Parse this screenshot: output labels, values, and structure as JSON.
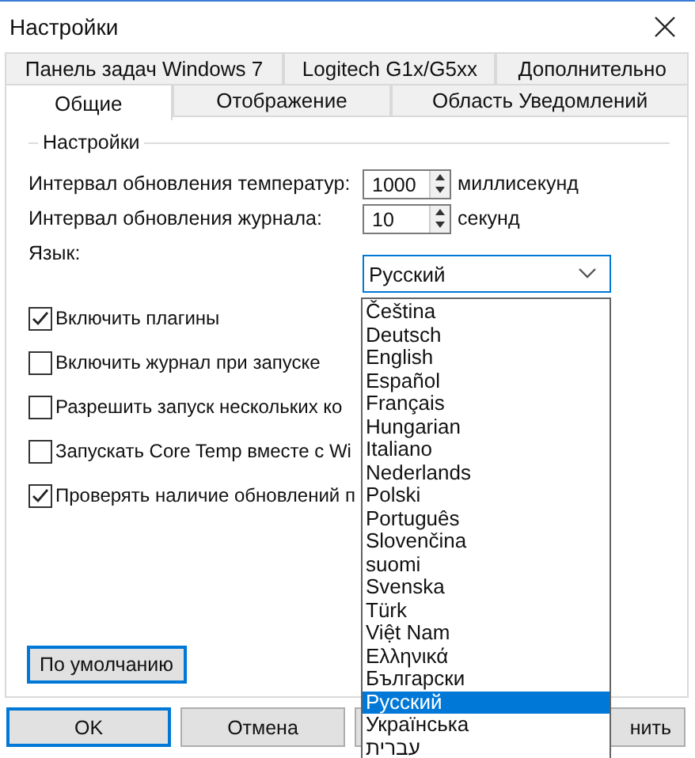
{
  "window": {
    "title": "Настройки"
  },
  "tab_rows": [
    [
      {
        "label": "Панель задач Windows 7",
        "selected": false
      },
      {
        "label": "Logitech G1x/G5xx",
        "selected": false
      },
      {
        "label": "Дополнительно",
        "selected": false
      }
    ],
    [
      {
        "label": "Общие",
        "selected": true
      },
      {
        "label": "Отображение",
        "selected": false
      },
      {
        "label": "Область Уведомлений",
        "selected": false
      }
    ]
  ],
  "group": {
    "title": "Настройки"
  },
  "spinners": [
    {
      "label": "Интервал обновления температур:",
      "value": "1000",
      "unit": "миллисекунд"
    },
    {
      "label": "Интервал обновления журнала:",
      "value": "10",
      "unit": "секунд"
    }
  ],
  "language": {
    "label": "Язык:",
    "value": "Русский",
    "options": [
      {
        "label": "Čeština",
        "selected": false
      },
      {
        "label": "Deutsch",
        "selected": false
      },
      {
        "label": "English",
        "selected": false
      },
      {
        "label": "Español",
        "selected": false
      },
      {
        "label": "Français",
        "selected": false
      },
      {
        "label": "Hungarian",
        "selected": false
      },
      {
        "label": "Italiano",
        "selected": false
      },
      {
        "label": "Nederlands",
        "selected": false
      },
      {
        "label": "Polski",
        "selected": false
      },
      {
        "label": "Português",
        "selected": false
      },
      {
        "label": "Slovenčina",
        "selected": false
      },
      {
        "label": "suomi",
        "selected": false
      },
      {
        "label": "Svenska",
        "selected": false
      },
      {
        "label": "Türk",
        "selected": false
      },
      {
        "label": "Việt Nam",
        "selected": false
      },
      {
        "label": "Ελληνικά",
        "selected": false
      },
      {
        "label": "Български",
        "selected": false
      },
      {
        "label": "Русский",
        "selected": true
      },
      {
        "label": "Українська",
        "selected": false
      },
      {
        "label": "עברית",
        "selected": false
      }
    ]
  },
  "checkboxes": [
    {
      "label": "Включить плагины",
      "checked": true
    },
    {
      "label": "Включить журнал при запуске",
      "checked": false
    },
    {
      "label": "Разрешить запуск нескольких ко",
      "checked": false
    },
    {
      "label": "Запускать Core Temp вместе с Wi",
      "checked": false
    },
    {
      "label": "Проверять наличие обновлений п",
      "checked": true
    }
  ],
  "defaults_button": "По умолчанию",
  "buttons": [
    {
      "label": "OK",
      "default": true
    },
    {
      "label": "Отмена",
      "default": false
    },
    {
      "label": "нить",
      "default": false
    }
  ]
}
